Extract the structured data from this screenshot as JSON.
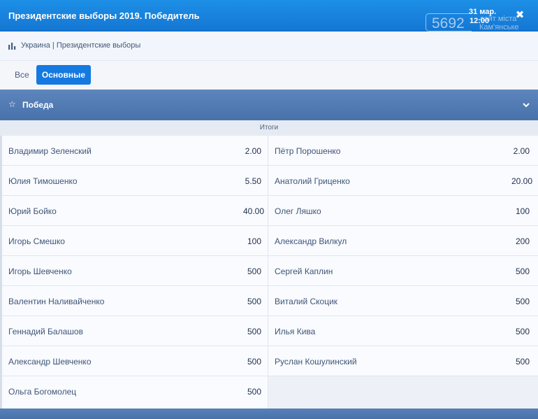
{
  "header": {
    "title": "Президентские выборы 2019. Победитель",
    "date": "31 мар.",
    "time": "12:00",
    "close_glyph": "✖"
  },
  "watermark": {
    "number": "5692",
    "line1": "сайт міста",
    "line2": "Кам'янське"
  },
  "breadcrumb": {
    "text": "Украина | Президентские выборы"
  },
  "tabs": {
    "all": "Все",
    "main": "Основные"
  },
  "section": {
    "title": "Победа",
    "subheader": "Итоги"
  },
  "left_column": [
    {
      "name": "Владимир Зеленский",
      "odd": "2.00"
    },
    {
      "name": "Юлия Тимошенко",
      "odd": "5.50"
    },
    {
      "name": "Юрий Бойко",
      "odd": "40.00"
    },
    {
      "name": "Игорь Смешко",
      "odd": "100"
    },
    {
      "name": "Игорь Шевченко",
      "odd": "500"
    },
    {
      "name": "Валентин Наливайченко",
      "odd": "500"
    },
    {
      "name": "Геннадий Балашов",
      "odd": "500"
    },
    {
      "name": "Александр Шевченко",
      "odd": "500"
    },
    {
      "name": "Ольга Богомолец",
      "odd": "500"
    }
  ],
  "right_column": [
    {
      "name": "Пётр Порошенко",
      "odd": "2.00"
    },
    {
      "name": "Анатолий Гриценко",
      "odd": "20.00"
    },
    {
      "name": "Олег Ляшко",
      "odd": "100"
    },
    {
      "name": "Александр Вилкул",
      "odd": "200"
    },
    {
      "name": "Сергей Каплин",
      "odd": "500"
    },
    {
      "name": "Виталий Скоцик",
      "odd": "500"
    },
    {
      "name": "Илья Кива",
      "odd": "500"
    },
    {
      "name": "Руслан Кошулинский",
      "odd": "500"
    }
  ],
  "colors": {
    "header_blue": "#1477d3",
    "section_blue": "#4b74ad",
    "active_tab": "#1479e0"
  },
  "icons": {
    "breadcrumb": "bar-chart-icon",
    "section": "star-outline-icon",
    "collapse": "chevron-down-icon",
    "close": "close-icon"
  }
}
